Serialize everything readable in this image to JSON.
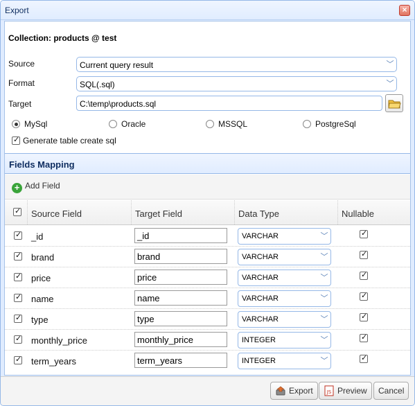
{
  "window": {
    "title": "Export"
  },
  "collection_label": "Collection: products @ test",
  "source": {
    "label": "Source",
    "value": "Current query result"
  },
  "format": {
    "label": "Format",
    "value": "SQL(.sql)"
  },
  "target": {
    "label": "Target",
    "value": "C:\\temp\\products.sql"
  },
  "dialects": [
    {
      "label": "MySql",
      "selected": true
    },
    {
      "label": "Oracle",
      "selected": false
    },
    {
      "label": "MSSQL",
      "selected": false
    },
    {
      "label": "PostgreSql",
      "selected": false
    }
  ],
  "generate_create": {
    "label": "Generate table create sql",
    "checked": true
  },
  "mapping": {
    "title": "Fields Mapping",
    "add_label": "Add Field",
    "columns": {
      "source": "Source Field",
      "target": "Target Field",
      "type": "Data Type",
      "nullable": "Nullable"
    },
    "rows": [
      {
        "source": "_id",
        "target": "_id",
        "type": "VARCHAR"
      },
      {
        "source": "brand",
        "target": "brand",
        "type": "VARCHAR"
      },
      {
        "source": "price",
        "target": "price",
        "type": "VARCHAR"
      },
      {
        "source": "name",
        "target": "name",
        "type": "VARCHAR"
      },
      {
        "source": "type",
        "target": "type",
        "type": "VARCHAR"
      },
      {
        "source": "monthly_price",
        "target": "monthly_price",
        "type": "INTEGER"
      },
      {
        "source": "term_years",
        "target": "term_years",
        "type": "INTEGER"
      }
    ]
  },
  "buttons": {
    "export": "Export",
    "preview": "Preview",
    "cancel": "Cancel"
  }
}
